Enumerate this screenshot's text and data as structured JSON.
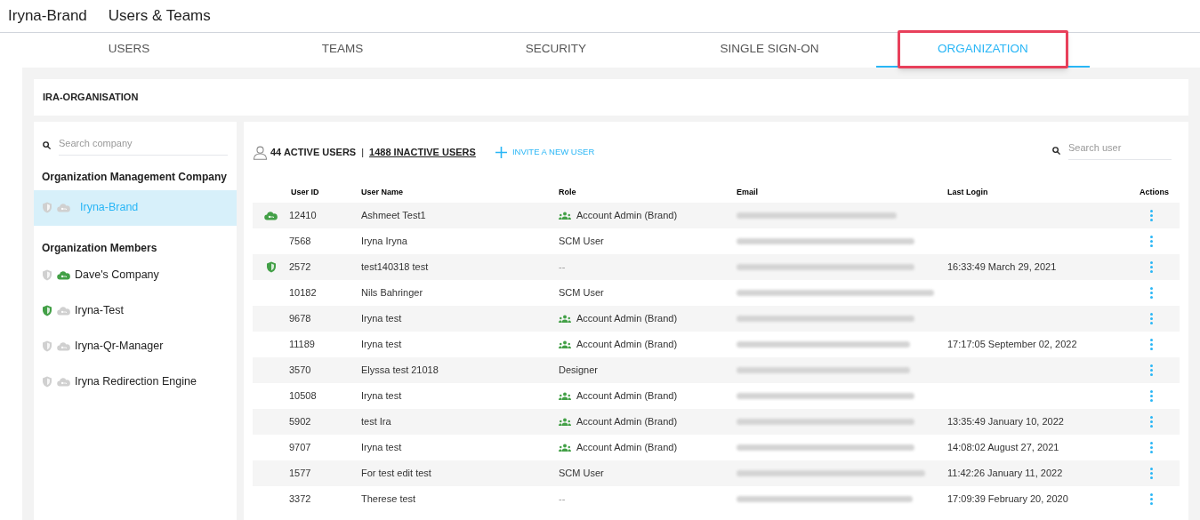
{
  "header": {
    "app_title": "Iryna-Brand",
    "page_title": "Users & Teams"
  },
  "tabs": [
    {
      "label": "USERS",
      "selected": false,
      "highlighted": false
    },
    {
      "label": "TEAMS",
      "selected": false,
      "highlighted": false
    },
    {
      "label": "SECURITY",
      "selected": false,
      "highlighted": false
    },
    {
      "label": "SINGLE SIGN-ON",
      "selected": false,
      "highlighted": false
    },
    {
      "label": "ORGANIZATION",
      "selected": true,
      "highlighted": true
    }
  ],
  "organization": {
    "name": "IRA-ORGANISATION"
  },
  "sidebar": {
    "search": {
      "placeholder": "Search company"
    },
    "sections": [
      {
        "title": "Organization Management Company",
        "items": [
          {
            "label": "Iryna-Brand",
            "selected": true,
            "shield": false,
            "cloud": false
          }
        ]
      },
      {
        "title": "Organization Members",
        "items": [
          {
            "label": "Dave's Company",
            "selected": false,
            "shield": false,
            "cloud": true
          },
          {
            "label": "Iryna-Test",
            "selected": false,
            "shield": true,
            "cloud": false
          },
          {
            "label": "Iryna-Qr-Manager",
            "selected": false,
            "shield": false,
            "cloud": false
          },
          {
            "label": "Iryna Redirection Engine",
            "selected": false,
            "shield": false,
            "cloud": false
          }
        ]
      }
    ]
  },
  "summary": {
    "active": "44 ACTIVE USERS",
    "separator": "|",
    "inactive": "1488 INACTIVE USERS",
    "invite": "INVITE A NEW USER"
  },
  "user_search": {
    "placeholder": "Search user"
  },
  "table": {
    "columns": [
      "User ID",
      "User Name",
      "Role",
      "Email",
      "Last Login",
      "Actions"
    ],
    "rows": [
      {
        "shield": false,
        "cloud": true,
        "id": "12410",
        "name": "Ashmeet Test1",
        "role": "Account Admin (Brand)",
        "role_icon": true,
        "last_login": ""
      },
      {
        "shield": false,
        "cloud": false,
        "id": "7568",
        "name": "Iryna Iryna",
        "role": "SCM User",
        "role_icon": false,
        "last_login": ""
      },
      {
        "shield": true,
        "cloud": false,
        "id": "2572",
        "name": "test140318 test",
        "role": "--",
        "role_icon": false,
        "last_login": "16:33:49 March 29, 2021"
      },
      {
        "shield": false,
        "cloud": false,
        "id": "10182",
        "name": "Nils Bahringer",
        "role": "SCM User",
        "role_icon": false,
        "last_login": ""
      },
      {
        "shield": false,
        "cloud": false,
        "id": "9678",
        "name": "Iryna test",
        "role": "Account Admin (Brand)",
        "role_icon": true,
        "last_login": ""
      },
      {
        "shield": false,
        "cloud": false,
        "id": "11189",
        "name": "Iryna test",
        "role": "Account Admin (Brand)",
        "role_icon": true,
        "last_login": "17:17:05 September 02, 2022"
      },
      {
        "shield": false,
        "cloud": false,
        "id": "3570",
        "name": "Elyssa test 21018",
        "role": "Designer",
        "role_icon": false,
        "last_login": ""
      },
      {
        "shield": false,
        "cloud": false,
        "id": "10508",
        "name": "Iryna test",
        "role": "Account Admin (Brand)",
        "role_icon": true,
        "last_login": ""
      },
      {
        "shield": false,
        "cloud": false,
        "id": "5902",
        "name": "test Ira",
        "role": "Account Admin (Brand)",
        "role_icon": true,
        "last_login": "13:35:49 January 10, 2022"
      },
      {
        "shield": false,
        "cloud": false,
        "id": "9707",
        "name": "Iryna test",
        "role": "Account Admin (Brand)",
        "role_icon": true,
        "last_login": "14:08:02 August 27, 2021"
      },
      {
        "shield": false,
        "cloud": false,
        "id": "1577",
        "name": "For test edit test",
        "role": "SCM User",
        "role_icon": false,
        "last_login": "11:42:26 January 11, 2022"
      },
      {
        "shield": false,
        "cloud": false,
        "id": "3372",
        "name": "Therese test",
        "role": "--",
        "role_icon": false,
        "last_login": "17:09:39 February 20, 2020"
      }
    ]
  }
}
